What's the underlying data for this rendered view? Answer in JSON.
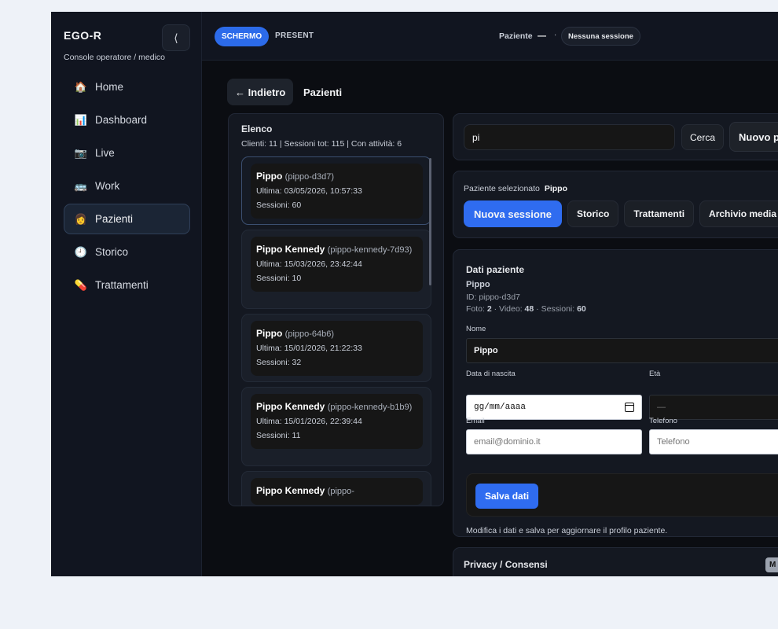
{
  "sidebar": {
    "brand": "EGO-R",
    "subtitle": "Console operatore / medico",
    "collapse": "⟨",
    "items": [
      {
        "label": "Home",
        "icon": "🏠"
      },
      {
        "label": "Dashboard",
        "icon": "📊"
      },
      {
        "label": "Live",
        "icon": "📷"
      },
      {
        "label": "Work",
        "icon": "🚌"
      },
      {
        "label": "Pazienti",
        "icon": "👩"
      },
      {
        "label": "Storico",
        "icon": "🕘"
      },
      {
        "label": "Trattamenti",
        "icon": "💊"
      }
    ]
  },
  "topbar": {
    "mode_active": "SCHERMO",
    "mode_alt": "PRESENT",
    "patient_label": "Paziente",
    "patient_value": "—",
    "separator": "·",
    "session": "Nessuna sessione"
  },
  "header": {
    "back": "← Indietro",
    "title": "Pazienti"
  },
  "list": {
    "title": "Elenco",
    "stats": "Clienti: 11 | Sessioni tot: 115 | Con attività: 6",
    "patients": [
      {
        "name": "Pippo",
        "id": "(pippo-d3d7)",
        "last": "Ultima: 03/05/2026, 10:57:33",
        "sessions": "Sessioni: 60"
      },
      {
        "name": "Pippo Kennedy",
        "id": "(pippo-kennedy-7d93)",
        "last": "Ultima: 15/03/2026, 23:42:44",
        "sessions": "Sessioni: 10"
      },
      {
        "name": "Pippo",
        "id": "(pippo-64b6)",
        "last": "Ultima: 15/01/2026, 21:22:33",
        "sessions": "Sessioni: 32"
      },
      {
        "name": "Pippo Kennedy",
        "id": "(pippo-kennedy-b1b9)",
        "last": "Ultima: 15/01/2026, 22:39:44",
        "sessions": "Sessioni: 11"
      },
      {
        "name": "Pippo Kennedy",
        "id": "(pippo-",
        "last": "",
        "sessions": ""
      }
    ]
  },
  "search": {
    "value": "pi",
    "button": "Cerca",
    "new_button": "Nuovo p"
  },
  "selected": {
    "label": "Paziente selezionato",
    "name": "Pippo",
    "actions": [
      "Nuova sessione",
      "Storico",
      "Trattamenti",
      "Archivio media"
    ]
  },
  "details": {
    "title": "Dati paziente",
    "name": "Pippo",
    "id": "ID: pippo-d3d7",
    "stats_prefix_foto": "Foto: ",
    "foto": "2",
    "stats_video": " · Video: ",
    "video": "48",
    "stats_sessioni": " · Sessioni: ",
    "sessioni": "60",
    "fields": {
      "nome_label": "Nome",
      "nome_value": "Pippo",
      "nascita_label": "Data di nascita",
      "nascita_value": "gg/mm/aaaa",
      "eta_label": "Età",
      "eta_value": "—",
      "email_label": "Email",
      "email_placeholder": "email@dominio.it",
      "telefono_label": "Telefono",
      "telefono_placeholder": "Telefono"
    },
    "save": "Salva dati",
    "note": "Modifica i dati e salva per aggiornare il profilo paziente."
  },
  "privacy": {
    "title": "Privacy / Consensi",
    "badge": "M"
  },
  "colors": {
    "accent": "#2f6cf0",
    "background": "#0b0d12",
    "panel": "#141821"
  }
}
